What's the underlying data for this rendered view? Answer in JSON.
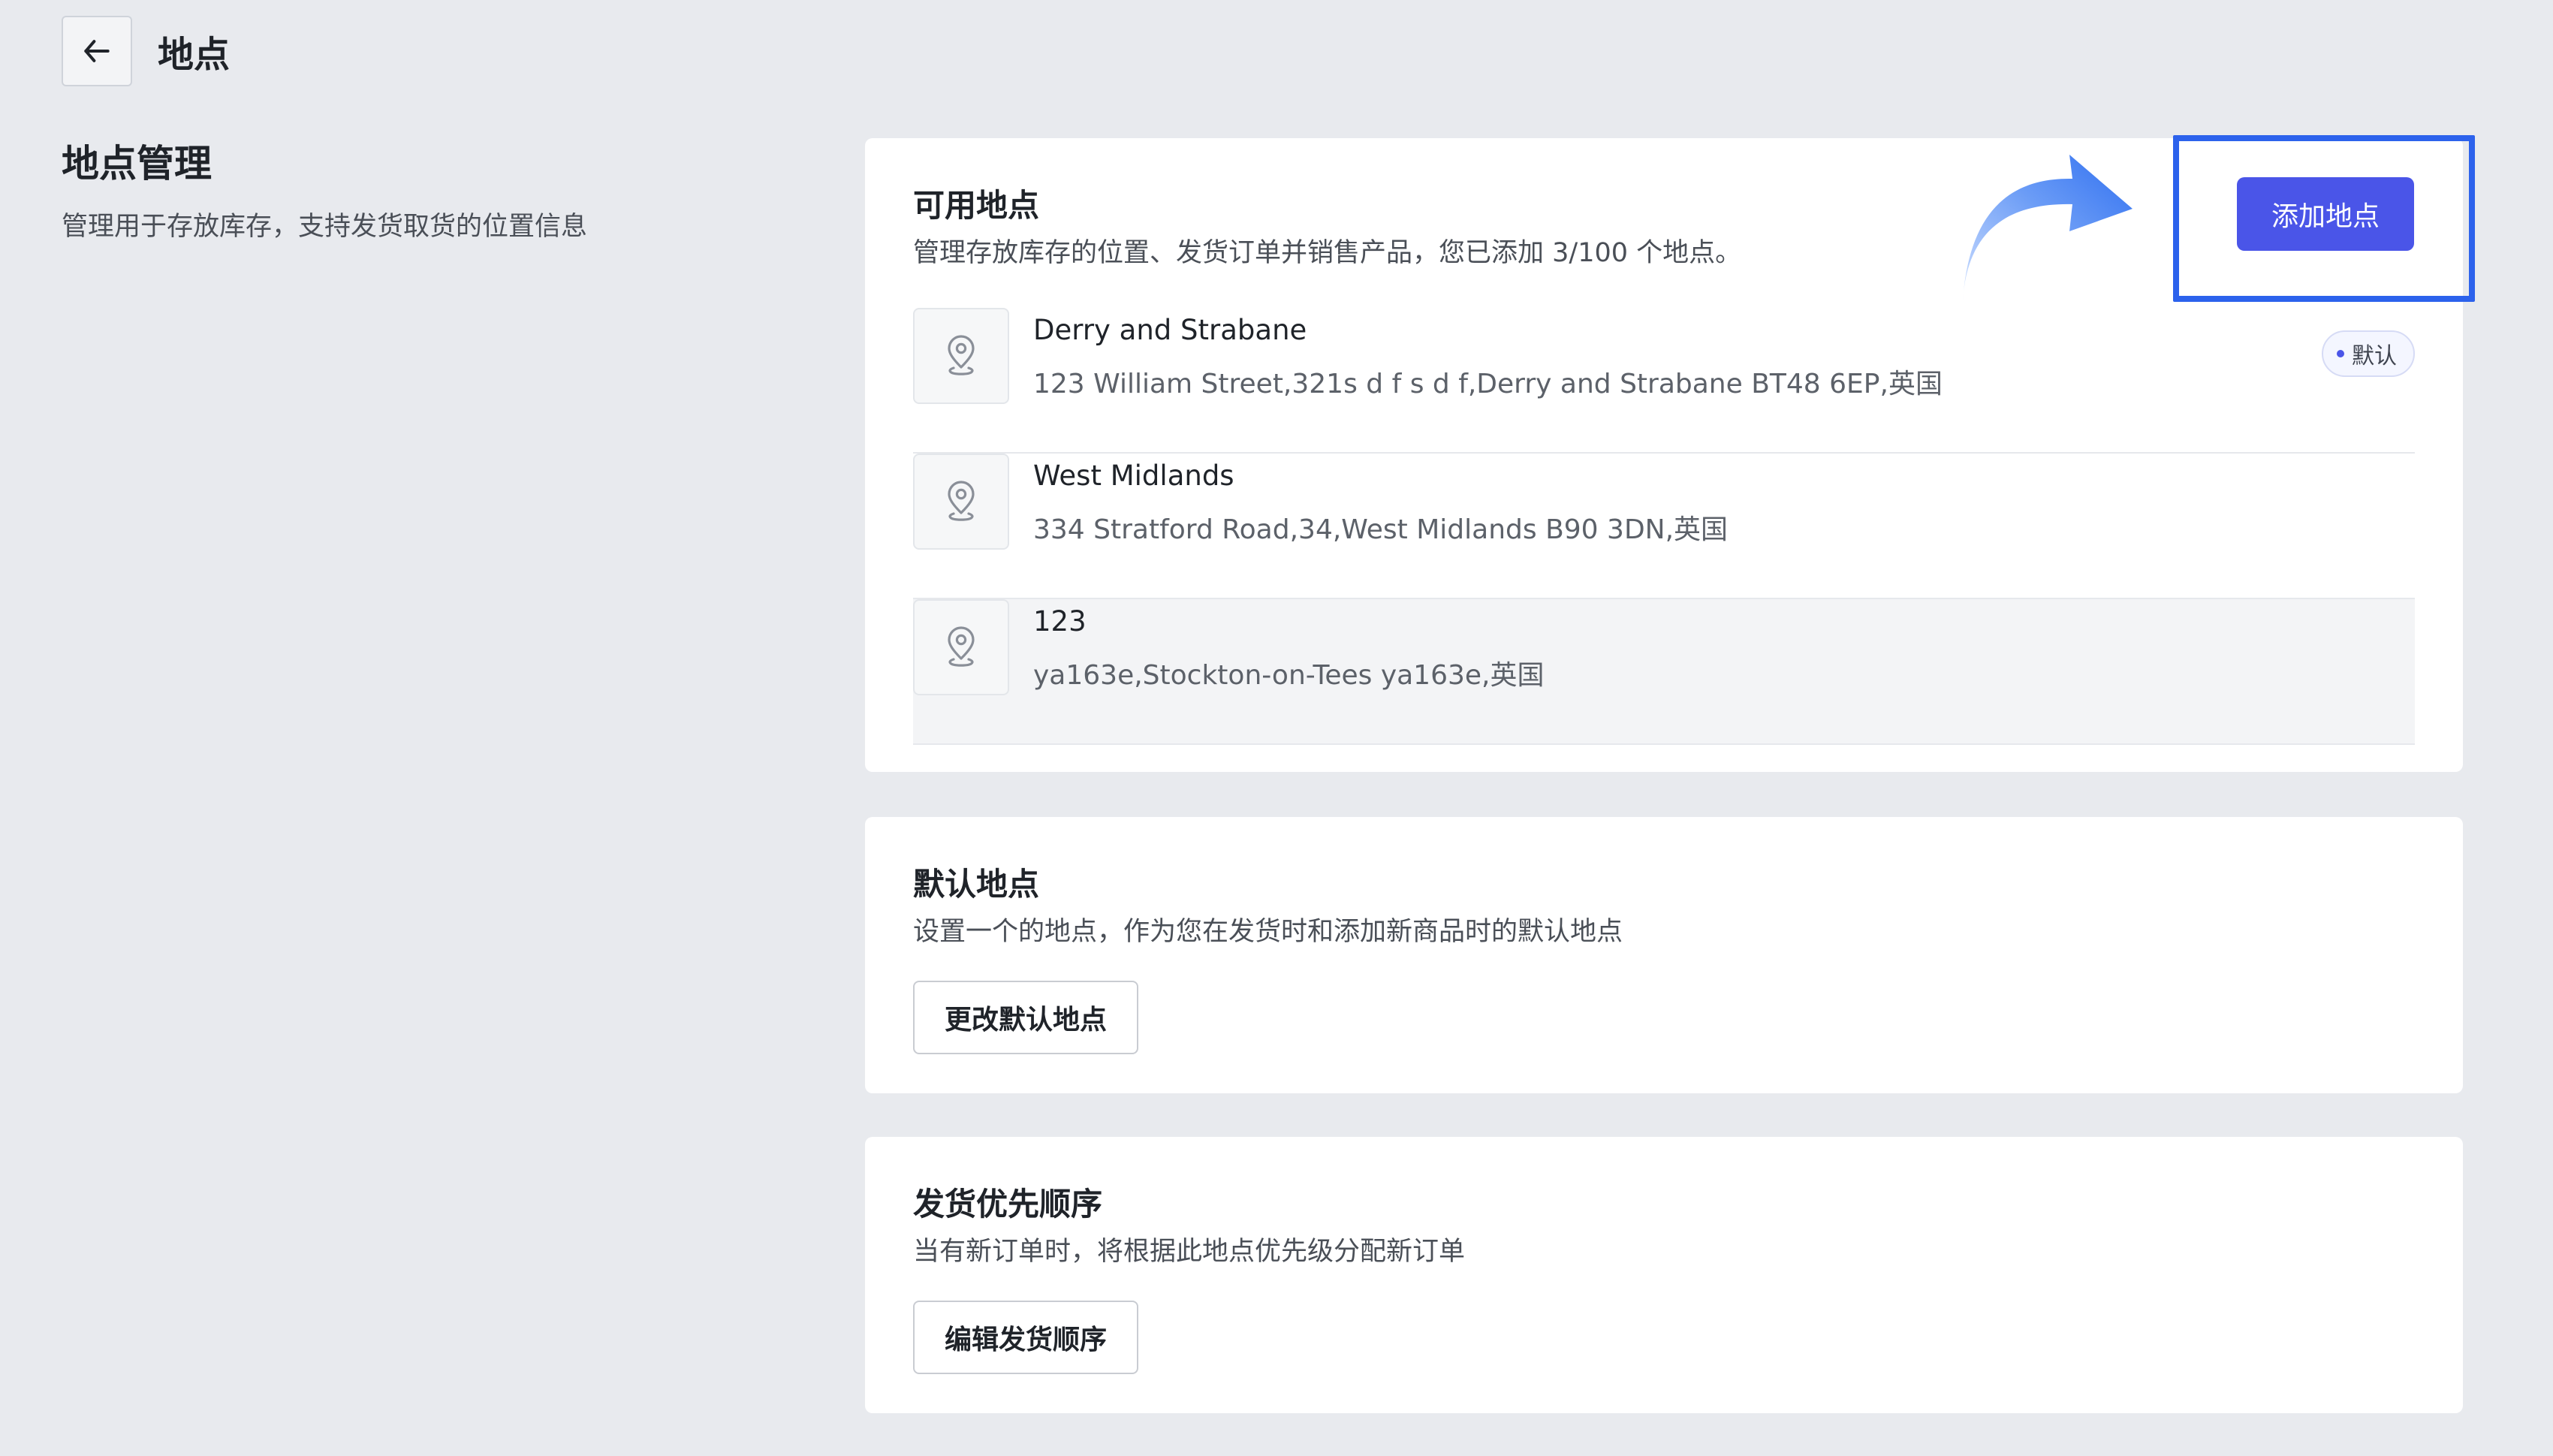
{
  "header": {
    "title": "地点"
  },
  "intro": {
    "title": "地点管理",
    "description": "管理用于存放库存，支持发货取货的位置信息"
  },
  "available_locations": {
    "title": "可用地点",
    "description": "管理存放库存的位置、发货订单并销售产品，您已添加 3/100 个地点。",
    "add_button_label": "添加地点",
    "default_badge_label": "默认",
    "items": [
      {
        "name": "Derry and Strabane",
        "address": "123 William Street,321s d f s d f,Derry and Strabane BT48 6EP,英国",
        "is_default": true
      },
      {
        "name": "West Midlands",
        "address": "334 Stratford Road,34,West Midlands B90 3DN,英国",
        "is_default": false
      },
      {
        "name": "123",
        "address": "ya163e,Stockton-on-Tees ya163e,英国",
        "is_default": false
      }
    ]
  },
  "default_location": {
    "title": "默认地点",
    "description": "设置一个的地点，作为您在发货时和添加新商品时的默认地点",
    "button_label": "更改默认地点"
  },
  "shipping_priority": {
    "title": "发货优先顺序",
    "description": "当有新订单时，将根据此地点优先级分配新订单",
    "button_label": "编辑发货顺序"
  },
  "colors": {
    "page_background": "#e8eaee",
    "accent": "#4a55e8",
    "highlight_box": "#2c62ec",
    "arrow": "#3d7cf2"
  },
  "icons": {
    "back": "arrow-left-icon",
    "location": "map-pin-icon",
    "annotation": "curved-arrow-icon"
  }
}
